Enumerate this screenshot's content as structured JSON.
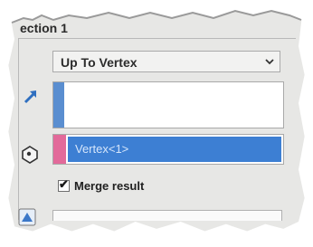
{
  "panel": {
    "title": "ection 1"
  },
  "end_condition": {
    "selected": "Up To Vertex"
  },
  "vertex_selection": {
    "value": "Vertex<1>"
  },
  "merge_result": {
    "label": "Merge result",
    "checked": true
  },
  "icons": {
    "dropdown": "chevron-down-icon",
    "direction": "reverse-direction-arrow-icon",
    "vertex": "vertex-icon",
    "bottom": "feature-scope-icon"
  },
  "colors": {
    "direction_strip": "#5a8ed0",
    "vertex_strip": "#e26a9a",
    "selection_highlight": "#3d7fd3"
  }
}
